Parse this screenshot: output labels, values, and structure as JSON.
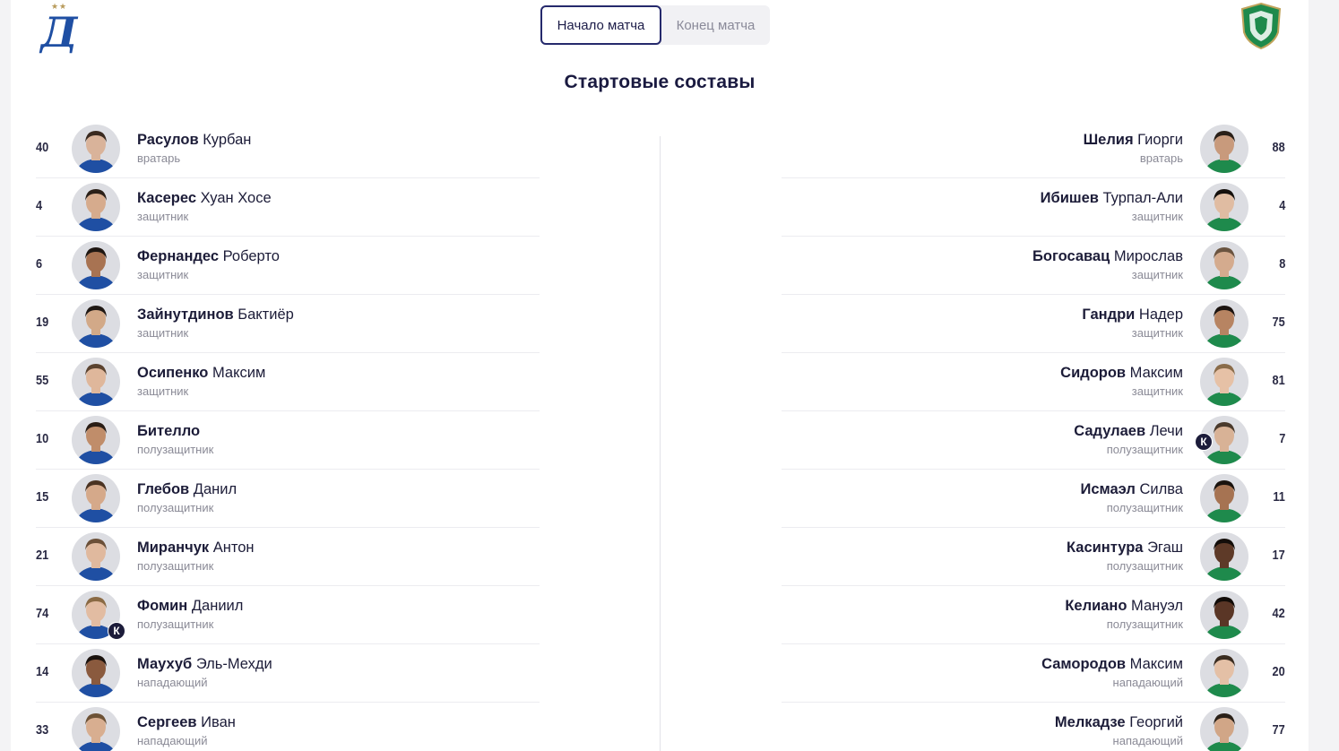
{
  "tabs": {
    "start": "Начало матча",
    "end": "Конец матча"
  },
  "title": "Стартовые составы",
  "captain_label": "К",
  "colors": {
    "dynamo_blue": "#1f4fa3",
    "akhmat_green": "#1e8a4c",
    "accent": "#25296c"
  },
  "home": [
    {
      "number": "40",
      "surname": "Расулов",
      "name": "Курбан",
      "position": "вратарь",
      "captain": false,
      "skin": "#d9b39a",
      "hair": "#3a2a20"
    },
    {
      "number": "4",
      "surname": "Касерес",
      "name": "Хуан Хосе",
      "position": "защитник",
      "captain": false,
      "skin": "#d6ab8d",
      "hair": "#2b2018"
    },
    {
      "number": "6",
      "surname": "Фернандес",
      "name": "Роберто",
      "position": "защитник",
      "captain": false,
      "skin": "#a87352",
      "hair": "#1f1712"
    },
    {
      "number": "19",
      "surname": "Зайнутдинов",
      "name": "Бактиёр",
      "position": "защитник",
      "captain": false,
      "skin": "#d2a988",
      "hair": "#1f1814"
    },
    {
      "number": "55",
      "surname": "Осипенко",
      "name": "Максим",
      "position": "защитник",
      "captain": false,
      "skin": "#dfb79b",
      "hair": "#5b4330"
    },
    {
      "number": "10",
      "surname": "Бителло",
      "name": "",
      "position": "полузащитник",
      "captain": false,
      "skin": "#c08d6a",
      "hair": "#2a1d15"
    },
    {
      "number": "15",
      "surname": "Глебов",
      "name": "Данил",
      "position": "полузащитник",
      "captain": false,
      "skin": "#d5a98a",
      "hair": "#4a3322"
    },
    {
      "number": "21",
      "surname": "Миранчук",
      "name": "Антон",
      "position": "полузащитник",
      "captain": false,
      "skin": "#e0b99e",
      "hair": "#6b5038"
    },
    {
      "number": "74",
      "surname": "Фомин",
      "name": "Даниил",
      "position": "полузащитник",
      "captain": true,
      "skin": "#e2bca2",
      "hair": "#8a6a44"
    },
    {
      "number": "14",
      "surname": "Маухуб",
      "name": "Эль-Мехди",
      "position": "нападающий",
      "captain": false,
      "skin": "#8a5a3e",
      "hair": "#1a120e"
    },
    {
      "number": "33",
      "surname": "Сергеев",
      "name": "Иван",
      "position": "нападающий",
      "captain": false,
      "skin": "#d8ae90",
      "hair": "#6d5236"
    }
  ],
  "away": [
    {
      "number": "88",
      "surname": "Шелия",
      "name": "Гиорги",
      "position": "вратарь",
      "captain": false,
      "skin": "#c89a7c",
      "hair": "#2a2019"
    },
    {
      "number": "4",
      "surname": "Ибишев",
      "name": "Турпал-Али",
      "position": "защитник",
      "captain": false,
      "skin": "#e0bca2",
      "hair": "#15100c"
    },
    {
      "number": "8",
      "surname": "Богосавац",
      "name": "Мирослав",
      "position": "защитник",
      "captain": false,
      "skin": "#d4ab8e",
      "hair": "#6a5440"
    },
    {
      "number": "75",
      "surname": "Гандри",
      "name": "Надер",
      "position": "защитник",
      "captain": false,
      "skin": "#b78462",
      "hair": "#1c1410"
    },
    {
      "number": "81",
      "surname": "Сидоров",
      "name": "Максим",
      "position": "защитник",
      "captain": false,
      "skin": "#e6c1a6",
      "hair": "#8a6c4a"
    },
    {
      "number": "7",
      "surname": "Садулаев",
      "name": "Лечи",
      "position": "полузащитник",
      "captain": true,
      "skin": "#d8b296",
      "hair": "#4a3a2c"
    },
    {
      "number": "11",
      "surname": "Исмаэл",
      "name": "Силва",
      "position": "полузащитник",
      "captain": false,
      "skin": "#a67352",
      "hair": "#1a130e"
    },
    {
      "number": "17",
      "surname": "Касинтура",
      "name": "Эгаш",
      "position": "полузащитник",
      "captain": false,
      "skin": "#5e3a28",
      "hair": "#140e0a"
    },
    {
      "number": "42",
      "surname": "Келиано",
      "name": "Мануэл",
      "position": "полузащитник",
      "captain": false,
      "skin": "#5a3626",
      "hair": "#120c08"
    },
    {
      "number": "20",
      "surname": "Самородов",
      "name": "Максим",
      "position": "нападающий",
      "captain": false,
      "skin": "#e4c0a6",
      "hair": "#3a2c20"
    },
    {
      "number": "77",
      "surname": "Мелкадзе",
      "name": "Георгий",
      "position": "нападающий",
      "captain": false,
      "skin": "#d1a687",
      "hair": "#2a2018"
    }
  ]
}
